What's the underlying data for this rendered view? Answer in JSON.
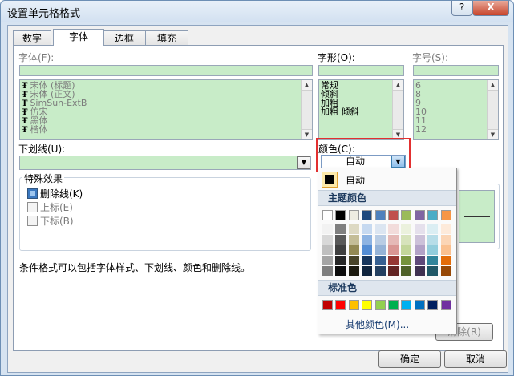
{
  "window": {
    "title": "设置单元格格式",
    "help": "?",
    "close": "X"
  },
  "tabs": [
    "数字",
    "字体",
    "边框",
    "填充"
  ],
  "font": {
    "label": "字体(F):",
    "items": [
      "宋体 (标题)",
      "宋体 (正文)",
      "SimSun-ExtB",
      "仿宋",
      "黑体",
      "楷体"
    ]
  },
  "style": {
    "label": "字形(O):",
    "items": [
      "常规",
      "倾斜",
      "加粗",
      "加粗 倾斜"
    ]
  },
  "size": {
    "label": "字号(S):",
    "items": [
      "6",
      "8",
      "9",
      "10",
      "11",
      "12"
    ]
  },
  "underline": {
    "label": "下划线(U):"
  },
  "color": {
    "label": "颜色(C):",
    "value": "自动"
  },
  "effects": {
    "label": "特殊效果",
    "strikethrough": {
      "label": "删除线(K)",
      "checked": true
    },
    "superscript": {
      "label": "上标(E)",
      "checked": false
    },
    "subscript": {
      "label": "下标(B)",
      "checked": false
    }
  },
  "info": "条件格式可以包括字体样式、下划线、颜色和删除线。",
  "popup": {
    "auto_label": "自动",
    "theme_title": "主题颜色",
    "standard_title": "标准色",
    "more_label": "其他颜色(M)...",
    "theme_top": [
      "#ffffff",
      "#000000",
      "#eeece1",
      "#1f497d",
      "#4f81bd",
      "#c0504d",
      "#9bbb59",
      "#8064a2",
      "#4bacc6",
      "#f79646"
    ],
    "theme_shades": [
      [
        "#f2f2f2",
        "#d8d8d8",
        "#bfbfbf",
        "#a5a5a5",
        "#7f7f7f"
      ],
      [
        "#7f7f7f",
        "#595959",
        "#3f3f3f",
        "#262626",
        "#0c0c0c"
      ],
      [
        "#ddd9c3",
        "#c4bd97",
        "#938953",
        "#494429",
        "#1d1b10"
      ],
      [
        "#c6d9f0",
        "#8db3e2",
        "#548dd4",
        "#17365d",
        "#0f243e"
      ],
      [
        "#dbe5f1",
        "#b8cce4",
        "#95b3d7",
        "#366092",
        "#244061"
      ],
      [
        "#f2dcdb",
        "#e5b9b7",
        "#d99694",
        "#953734",
        "#632423"
      ],
      [
        "#ebf1dd",
        "#d7e3bc",
        "#c3d69b",
        "#76923c",
        "#4f6128"
      ],
      [
        "#e5e0ec",
        "#ccc1d9",
        "#b2a2c7",
        "#5f497a",
        "#3f3151"
      ],
      [
        "#dbeef3",
        "#b7dde8",
        "#92cddc",
        "#31859b",
        "#205867"
      ],
      [
        "#fdeada",
        "#fbd5b5",
        "#fac08f",
        "#e36c09",
        "#974806"
      ]
    ],
    "standard": [
      "#c00000",
      "#ff0000",
      "#ffc000",
      "#ffff00",
      "#92d050",
      "#00b050",
      "#00b0f0",
      "#0070c0",
      "#002060",
      "#7030a0"
    ]
  },
  "buttons": {
    "clear": "清除(R)",
    "ok": "确定",
    "cancel": "取消"
  },
  "accent": {
    "highlight_border": "#e23030"
  }
}
